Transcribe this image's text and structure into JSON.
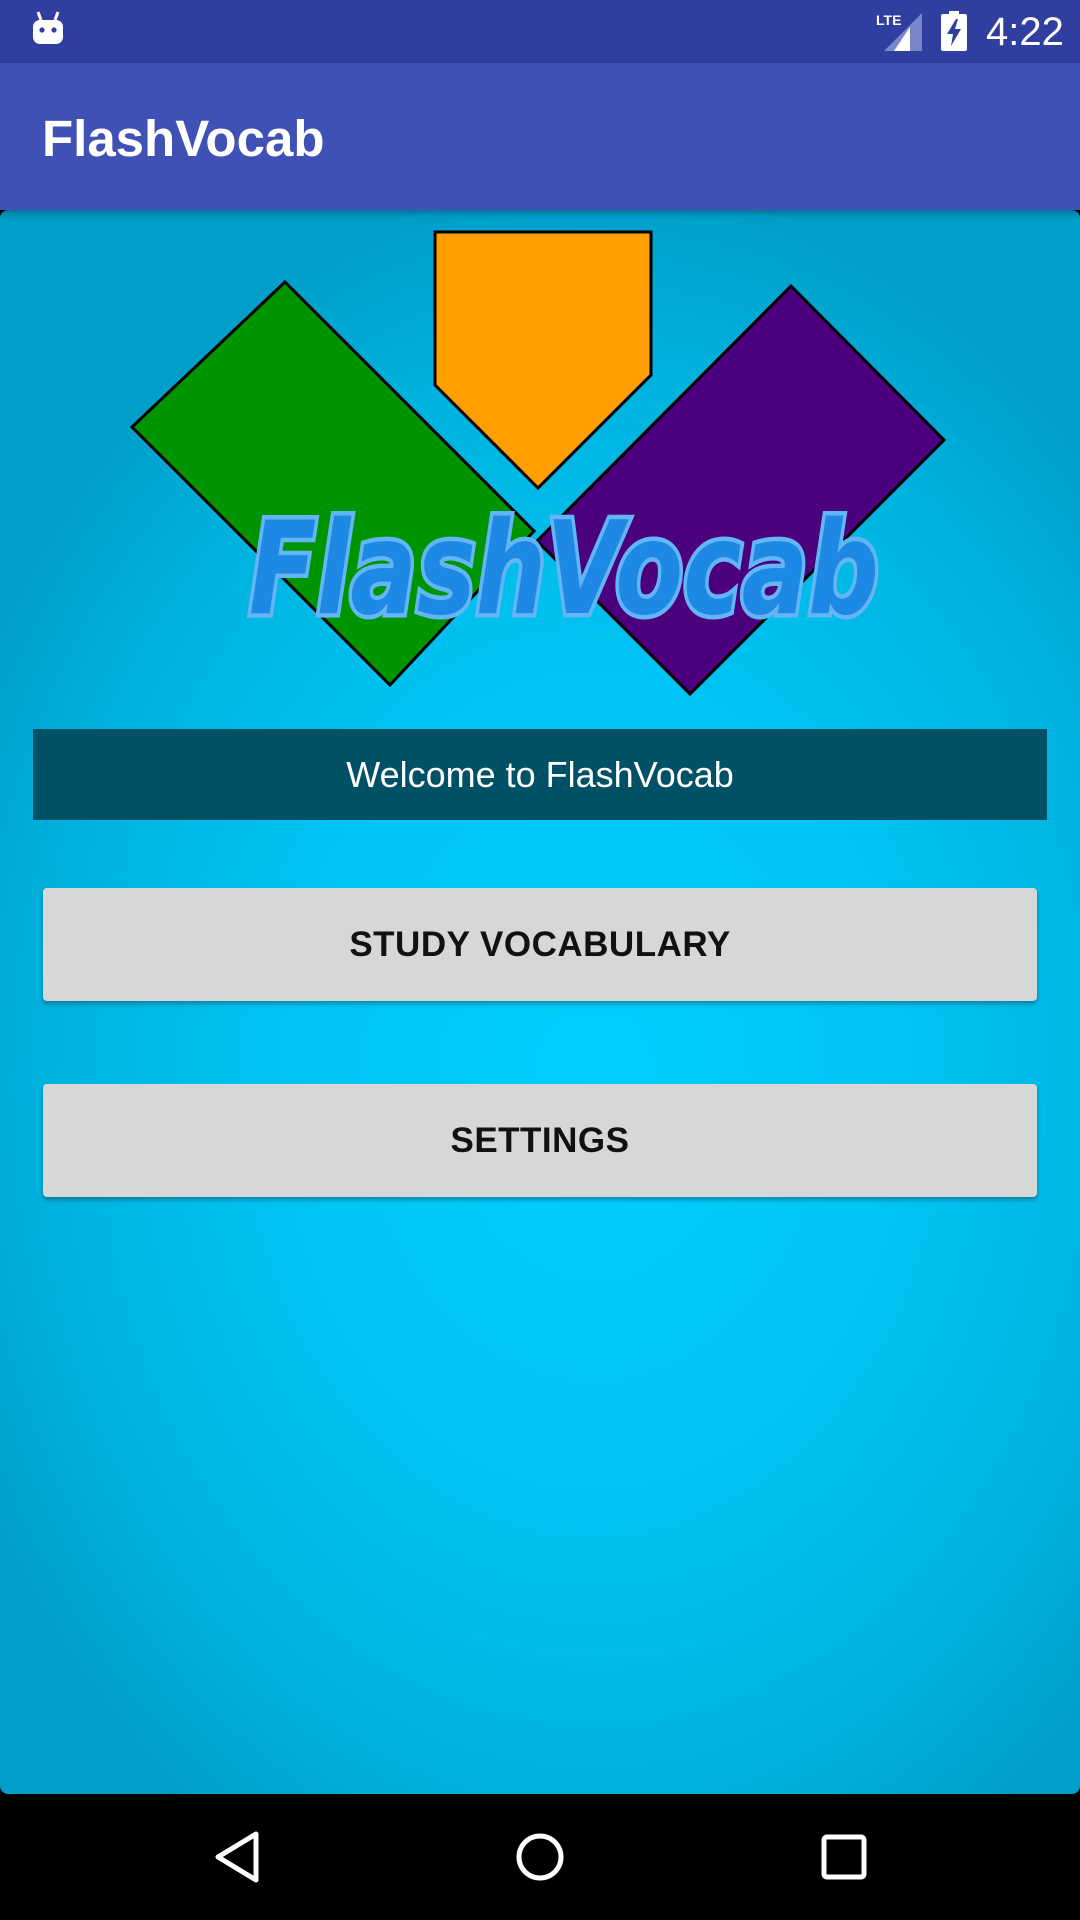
{
  "status_bar": {
    "time": "4:22",
    "network": "LTE",
    "icons": [
      "android-icon",
      "lte-signal-icon",
      "battery-charging-icon"
    ]
  },
  "app_bar": {
    "title": "FlashVocab"
  },
  "logo": {
    "text": "FlashVocab",
    "colors": {
      "green": "#009400",
      "orange": "#ff9e00",
      "purple": "#4b007d",
      "text_fill": "#1e88e5",
      "text_outline": "#64b5f6"
    }
  },
  "welcome": {
    "text": "Welcome to FlashVocab"
  },
  "buttons": {
    "study": "STUDY VOCABULARY",
    "settings": "SETTINGS"
  },
  "nav_bar": {
    "icons": [
      "back-icon",
      "home-icon",
      "recent-apps-icon"
    ]
  },
  "colors": {
    "status_bar": "#303f9f",
    "app_bar": "#3f51b5",
    "content_bg": "#00c8f8",
    "welcome_bg": "#005066",
    "button_bg": "#d6d7d7"
  }
}
